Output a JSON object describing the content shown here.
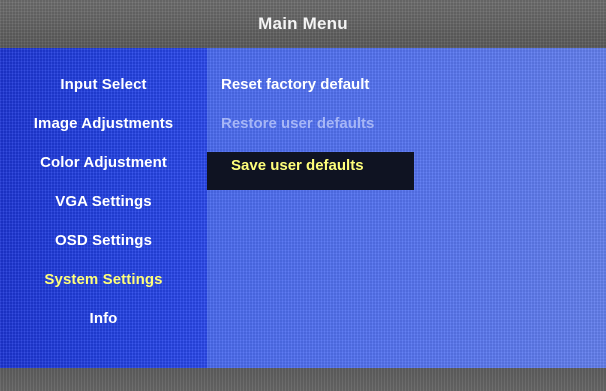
{
  "title": "Main Menu",
  "sidebar": {
    "items": [
      {
        "label": "Input Select"
      },
      {
        "label": "Image Adjustments"
      },
      {
        "label": "Color Adjustment"
      },
      {
        "label": "VGA Settings"
      },
      {
        "label": "OSD Settings"
      },
      {
        "label": "System Settings"
      },
      {
        "label": "Info"
      }
    ],
    "active_item": "System Settings"
  },
  "main": {
    "options": [
      {
        "label": "Reset factory default",
        "state": "enabled"
      },
      {
        "label": "Restore user defaults",
        "state": "disabled"
      },
      {
        "label": "Save user defaults",
        "state": "selected"
      }
    ]
  },
  "colors": {
    "title_bar": "#666666",
    "sidebar": "#2342e6",
    "main_panel": "#5675f2",
    "highlight": "#ffff7a",
    "selected_background": "#0f1322"
  }
}
